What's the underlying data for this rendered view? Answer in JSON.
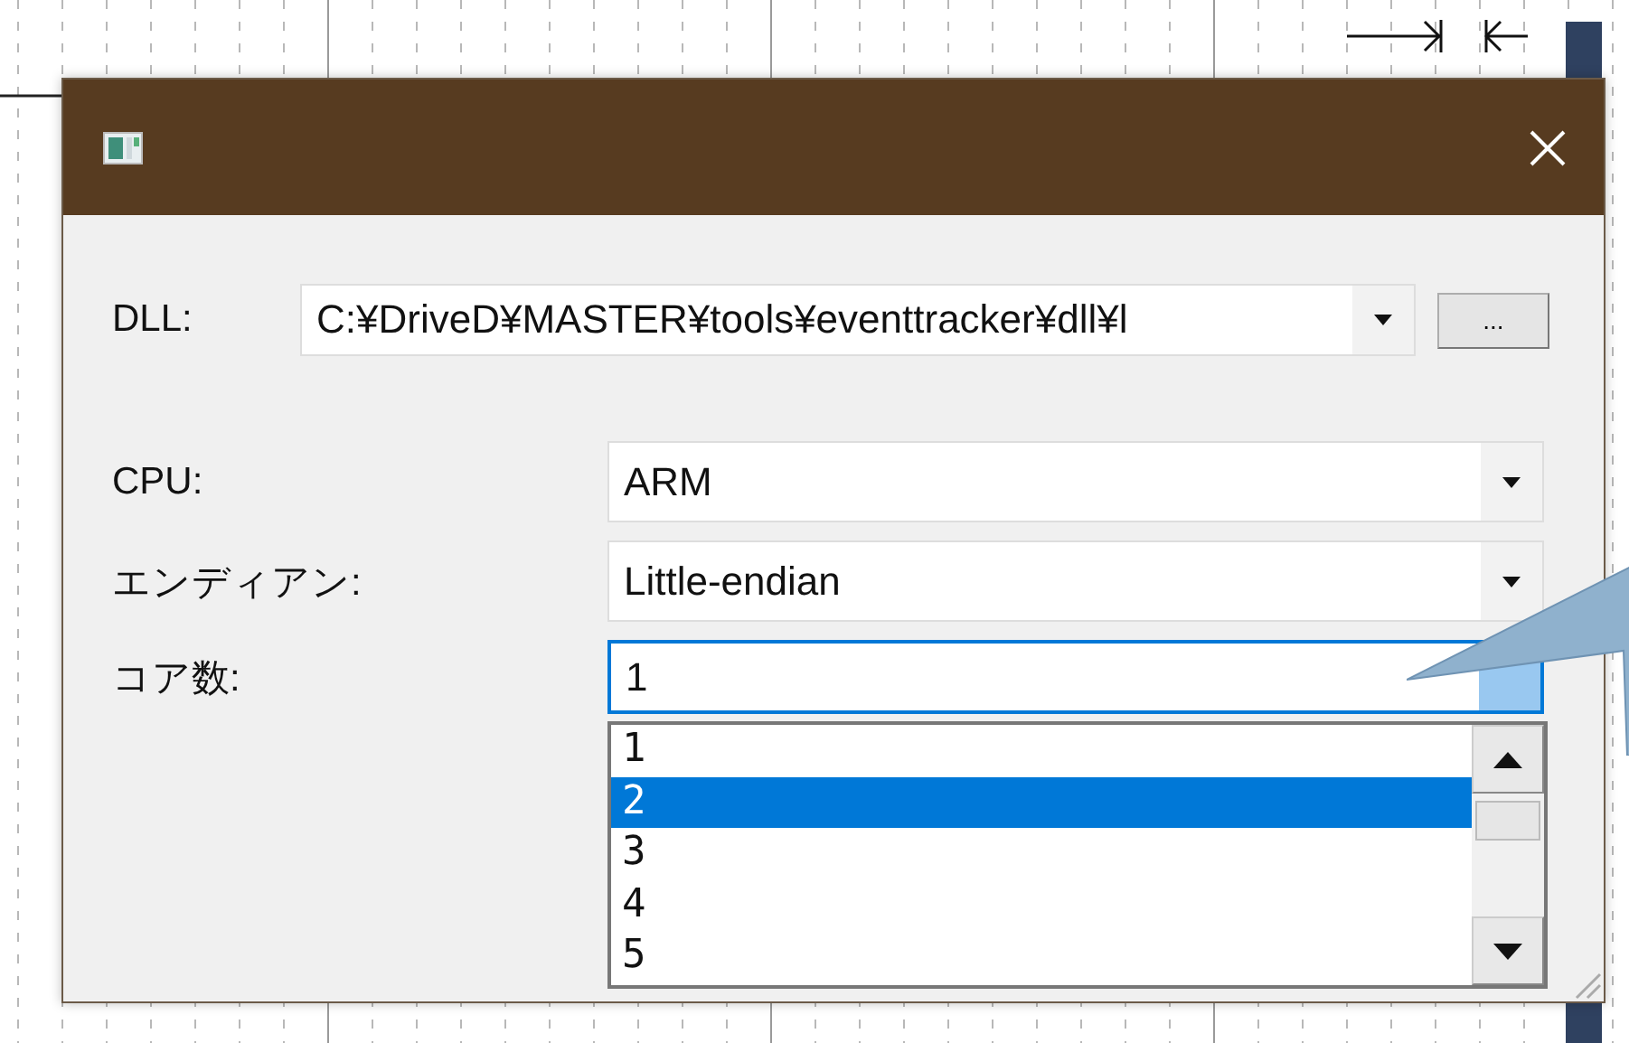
{
  "dialog": {
    "fields": [
      {
        "kind": "path",
        "label": "DLL:",
        "value": "C:¥DriveD¥MASTER¥tools¥eventtracker¥dll¥l",
        "browse": "...",
        "focused": false
      },
      {
        "kind": "combo",
        "label": "CPU:",
        "value": "ARM",
        "focused": false
      },
      {
        "kind": "combo",
        "label": "エンディアン:",
        "value": "Little-endian",
        "focused": false
      },
      {
        "kind": "combo",
        "label": "コア数:",
        "value": "1",
        "focused": true
      }
    ]
  },
  "dropdown_list": {
    "items": [
      {
        "label": "1",
        "selected": false
      },
      {
        "label": "2",
        "selected": true
      },
      {
        "label": "3",
        "selected": false
      },
      {
        "label": "4",
        "selected": false
      },
      {
        "label": "5",
        "selected": false
      }
    ]
  }
}
